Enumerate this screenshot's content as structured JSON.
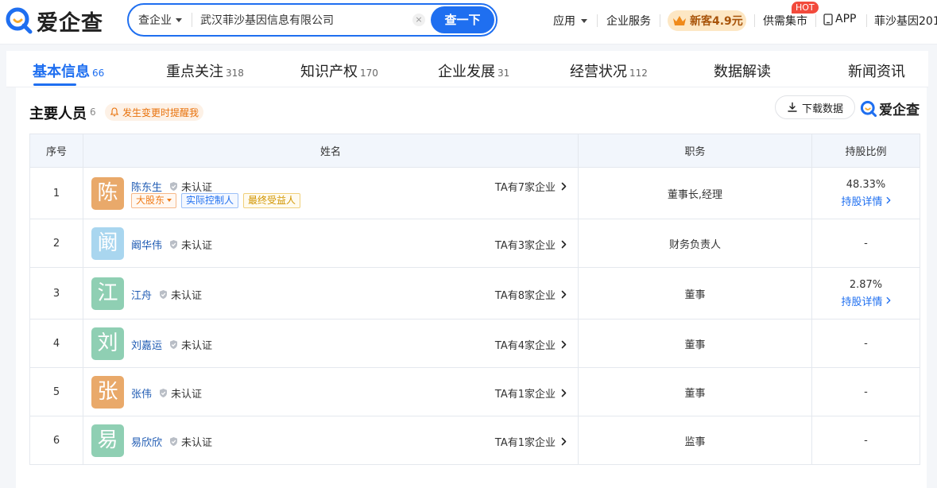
{
  "brand": {
    "logo_text": "爱企查"
  },
  "search": {
    "type_label": "查企业",
    "query": "武汉菲沙基因信息有限公司",
    "clear_symbol": "×",
    "button_label": "查一下"
  },
  "nav": {
    "apps": "应用",
    "enterprise_service": "企业服务",
    "vip_promo": "新客4.9元",
    "market": "供需集市",
    "hot_badge": "HOT",
    "app": "APP",
    "user": "菲沙基因201"
  },
  "tabs": [
    {
      "label": "基本信息",
      "count": "66",
      "active": true
    },
    {
      "label": "重点关注",
      "count": "318"
    },
    {
      "label": "知识产权",
      "count": "170"
    },
    {
      "label": "企业发展",
      "count": "31"
    },
    {
      "label": "经营状况",
      "count": "112"
    },
    {
      "label": "数据解读",
      "count": ""
    },
    {
      "label": "新闻资讯",
      "count": ""
    }
  ],
  "section": {
    "title": "主要人员",
    "count": "6",
    "remind_label": "发生变更时提醒我",
    "download_label": "下载数据",
    "watermark": "爱企查"
  },
  "table": {
    "headers": [
      "序号",
      "姓名",
      "职务",
      "持股比例"
    ],
    "unverified_label": "未认证",
    "share_detail_label": "持股详情",
    "rows": [
      {
        "index": "1",
        "avatar_char": "陈",
        "avatar_color": "#e9a96a",
        "name": "陈东生",
        "companies": "TA有7家企业",
        "position": "董事长,经理",
        "share": "48.33%",
        "has_detail": true,
        "tags": [
          "大股东",
          "实际控制人",
          "最终受益人"
        ]
      },
      {
        "index": "2",
        "avatar_char": "阚",
        "avatar_color": "#a9d6ef",
        "name": "阚华伟",
        "companies": "TA有3家企业",
        "position": "财务负责人",
        "share": "-",
        "has_detail": false
      },
      {
        "index": "3",
        "avatar_char": "江",
        "avatar_color": "#8fcfb3",
        "name": "江舟",
        "companies": "TA有8家企业",
        "position": "董事",
        "share": "2.87%",
        "has_detail": true
      },
      {
        "index": "4",
        "avatar_char": "刘",
        "avatar_color": "#8fcfb3",
        "name": "刘嘉运",
        "companies": "TA有4家企业",
        "position": "董事",
        "share": "-",
        "has_detail": false
      },
      {
        "index": "5",
        "avatar_char": "张",
        "avatar_color": "#e9a96a",
        "name": "张伟",
        "companies": "TA有1家企业",
        "position": "董事",
        "share": "-",
        "has_detail": false
      },
      {
        "index": "6",
        "avatar_char": "易",
        "avatar_color": "#8fcfb3",
        "name": "易欣欣",
        "companies": "TA有1家企业",
        "position": "监事",
        "share": "-",
        "has_detail": false
      }
    ]
  },
  "colors": {
    "accent": "#1f6ff0",
    "link": "#1f5bb3",
    "vip_bg": "#fde7c4",
    "hot": "#f24a3c"
  },
  "icons": [
    "logo-icon",
    "caret-down-icon",
    "clear-icon",
    "crown-icon",
    "app-device-icon",
    "bell-icon",
    "download-icon",
    "verify-shield-icon",
    "chevron-right-icon"
  ]
}
